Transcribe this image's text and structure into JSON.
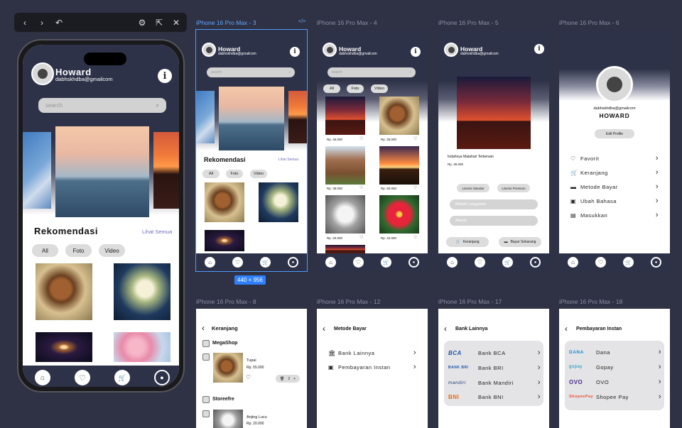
{
  "toolbar": {
    "back": "‹",
    "forward": "›",
    "undo": "↶",
    "settings": "⚙",
    "external": "⇱",
    "close": "✕"
  },
  "profile": {
    "name": "Howard",
    "email": "dabhskhdba@gmailcom",
    "name_upper": "HOWARD",
    "edit": "Edit Profile"
  },
  "search": {
    "placeholder": "search"
  },
  "home": {
    "section": "Rekomendasi",
    "see_all": "Lihat Semua",
    "chips": [
      "All",
      "Foto",
      "Video"
    ]
  },
  "frames": {
    "f3": "iPhone 16 Pro Max - 3",
    "f4": "iPhone 16 Pro Max - 4",
    "f5": "iPhone 16 Pro Max - 5",
    "f6": "iPhone 16 Pro Max - 6",
    "f8": "iPhone 16 Pro Max - 8",
    "f12": "iPhone 16 Pro Max - 12",
    "f17": "iPhone 16 Pro Max - 17",
    "f18": "iPhone 16 Pro Max - 18",
    "code_icon": "</>",
    "size": "440 × 956"
  },
  "grid": {
    "prices": [
      "Rp. 45.000",
      "Rp. 35.000",
      "Rp. 35.000",
      "Rp. 60.000",
      "Rp. 20.000",
      "Rp. 42.000"
    ]
  },
  "detail": {
    "title": "Indahnya Matahari Terbenam",
    "price": "Rp. 45.000",
    "license_std": "Lisensi Standar",
    "license_prem": "Lisensi Premium",
    "field1": "Metode Langganan",
    "field2": "Alamat",
    "cart": "Keranjang",
    "buy": "Bayar Sekarang"
  },
  "settings": {
    "items": [
      "Favorit",
      "Keranjang",
      "Metode Bayar",
      "Ubah Bahasa",
      "Masukkan"
    ]
  },
  "cart": {
    "title": "Keranjang",
    "shop1": "MegaShop",
    "item1": "Tupai",
    "price1": "Rp. 55.000",
    "qty": "2",
    "shop2": "Storeefre",
    "item2": "Anjing Lucu",
    "price2": "Rp. 20.000"
  },
  "payment": {
    "title": "Metode Bayar",
    "opt1": "Bank Lainnya",
    "opt2": "Pembayaran Instan"
  },
  "banks": {
    "title": "Bank Lainnya",
    "list": [
      {
        "logo": "BCA",
        "name": "Bank BCA"
      },
      {
        "logo": "BANK BRI",
        "name": "Bank BRI"
      },
      {
        "logo": "mandiri",
        "name": "Bank Mandiri"
      },
      {
        "logo": "BNI",
        "name": "Bank BNI"
      }
    ]
  },
  "instant": {
    "title": "Pembayaran Instan",
    "list": [
      {
        "logo": "DANA",
        "name": "Dana"
      },
      {
        "logo": "gopay",
        "name": "Gopay"
      },
      {
        "logo": "OVO",
        "name": "OVO"
      },
      {
        "logo": "ShopeePay",
        "name": "Shopee Pay"
      }
    ]
  }
}
